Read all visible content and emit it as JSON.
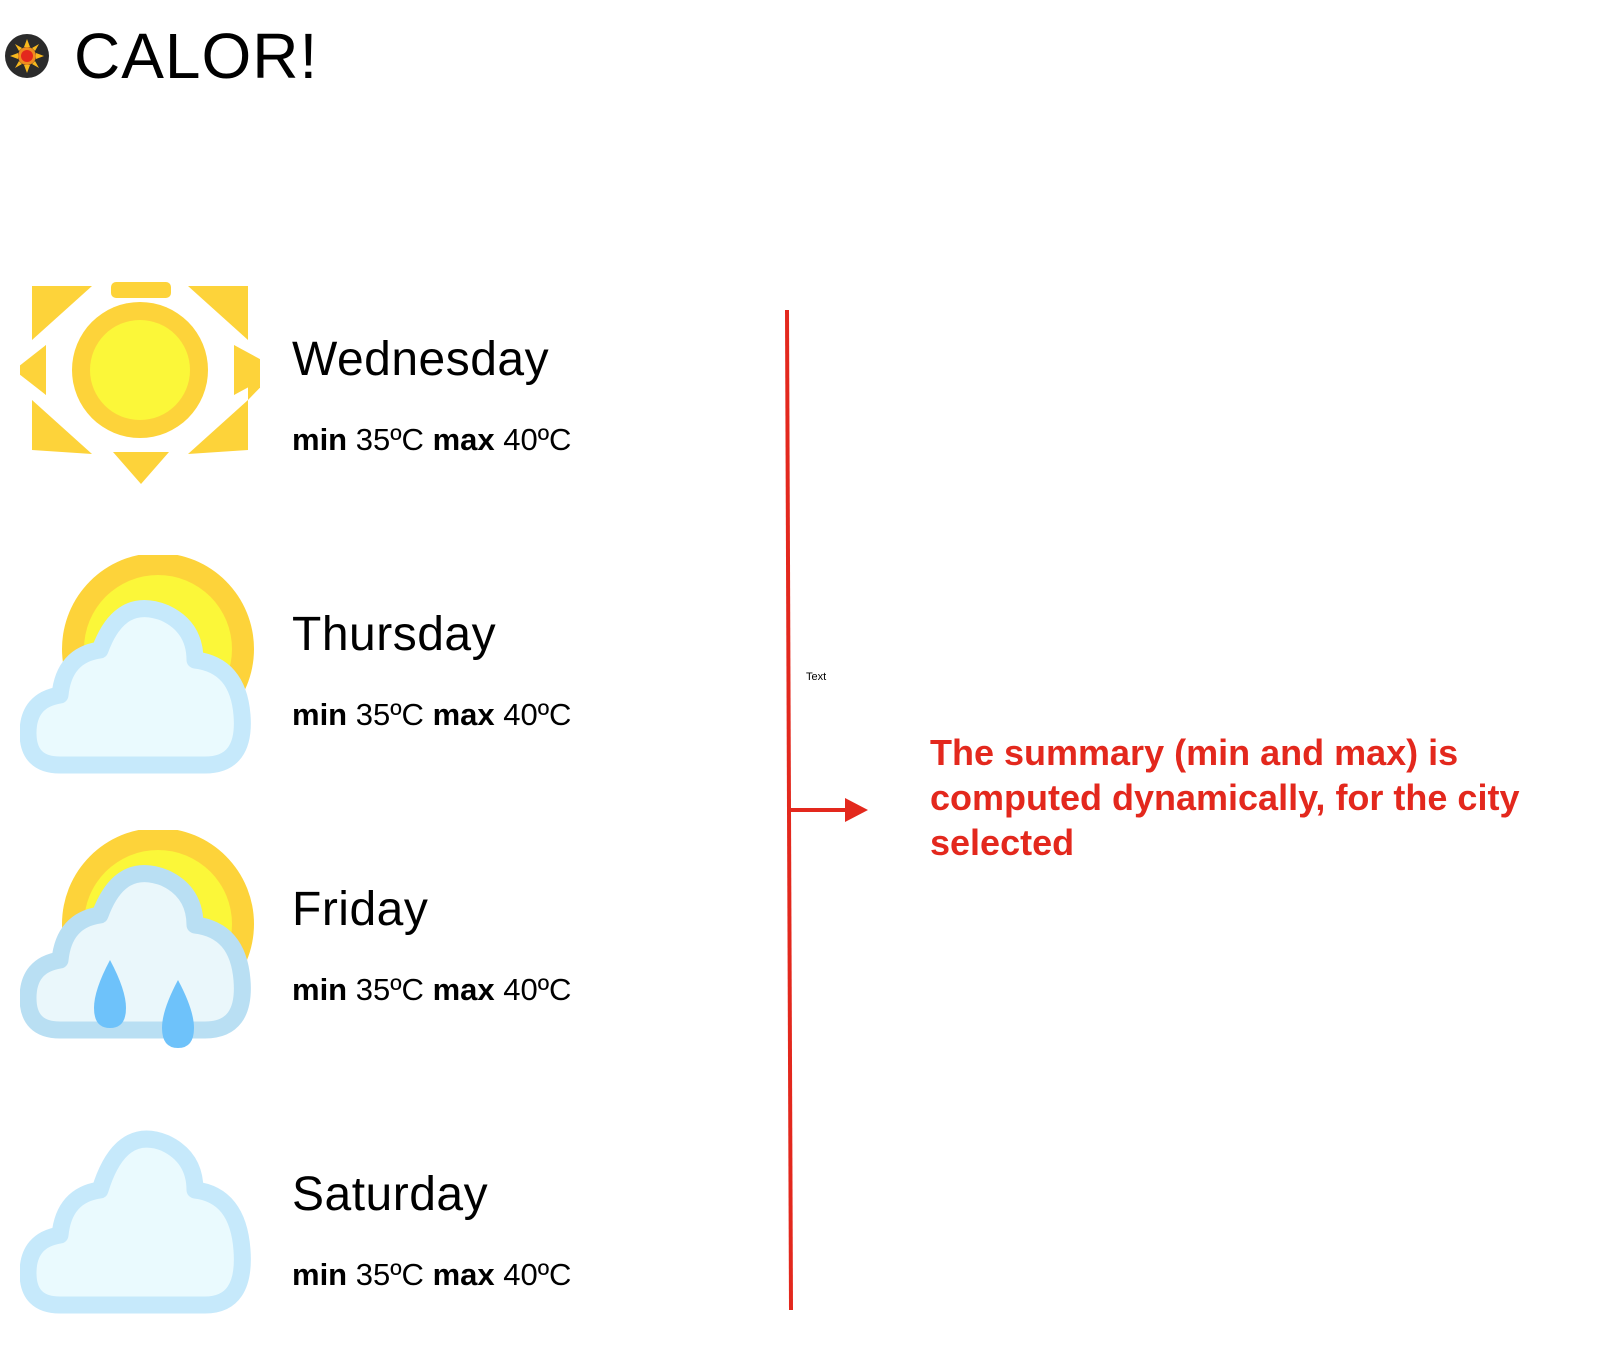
{
  "app": {
    "title": "CALOR!",
    "logo_icon": "sun-badge-icon"
  },
  "forecast": [
    {
      "day": "Wednesday",
      "icon": "sunny-icon",
      "min_label": "min",
      "min_value": "35ºC",
      "max_label": "max",
      "max_value": "40ºC"
    },
    {
      "day": "Thursday",
      "icon": "partly-cloudy-icon",
      "min_label": "min",
      "min_value": "35ºC",
      "max_label": "max",
      "max_value": "40ºC"
    },
    {
      "day": "Friday",
      "icon": "sun-rain-icon",
      "min_label": "min",
      "min_value": "35ºC",
      "max_label": "max",
      "max_value": "40ºC"
    },
    {
      "day": "Saturday",
      "icon": "cloud-icon",
      "min_label": "min",
      "min_value": "35ºC",
      "max_label": "max",
      "max_value": "40ºC"
    }
  ],
  "annotation": {
    "placeholder_text": "Text",
    "note": "The summary (min and max) is computed dynamically, for the city selected",
    "color": "#e3281d"
  }
}
